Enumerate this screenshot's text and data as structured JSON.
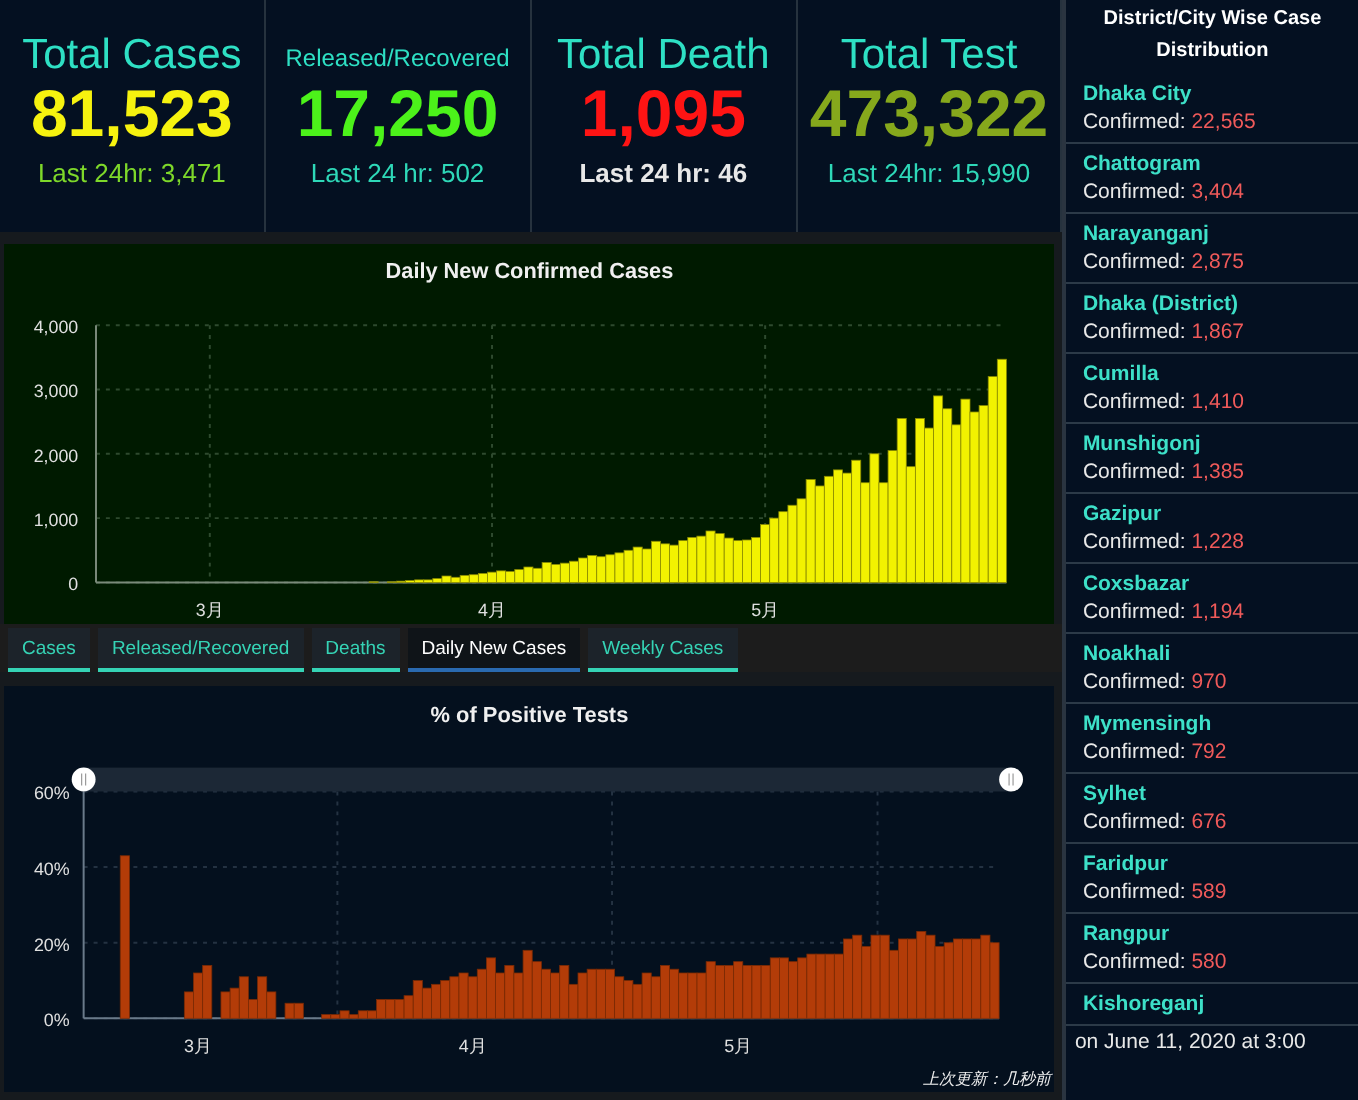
{
  "stats": [
    {
      "title": "Total Cases",
      "value": "81,523",
      "sub": "Last 24hr: 3,471",
      "color": "#f6f20f",
      "kind": "cases"
    },
    {
      "title": "Released/Recovered",
      "value": "17,250",
      "sub": "Last 24 hr: 502",
      "color": "#4cf21a",
      "kind": "recovered"
    },
    {
      "title": "Total Death",
      "value": "1,095",
      "sub": "Last 24 hr: 46",
      "color": "#ff1414",
      "kind": "death"
    },
    {
      "title": "Total Test",
      "value": "473,322",
      "sub": "Last 24hr: 15,990",
      "color": "#86a81c",
      "kind": "test"
    }
  ],
  "daily_chart": {
    "chart_data": {
      "type": "bar",
      "title": "Daily New Confirmed Cases",
      "categories": [
        null,
        null,
        null,
        null,
        null,
        null,
        null,
        null,
        null,
        null,
        null,
        null,
        "3月",
        null,
        null,
        null,
        null,
        null,
        null,
        null,
        null,
        null,
        null,
        null,
        null,
        null,
        null,
        null,
        null,
        null,
        null,
        null,
        null,
        null,
        null,
        null,
        null,
        null,
        null,
        null,
        null,
        null,
        null,
        "4月",
        null,
        null,
        null,
        null,
        null,
        null,
        null,
        null,
        null,
        null,
        null,
        null,
        null,
        null,
        null,
        null,
        null,
        null,
        null,
        null,
        null,
        null,
        null,
        null,
        null,
        null,
        null,
        null,
        null,
        "5月",
        null,
        null,
        null,
        null,
        null,
        null,
        null,
        null,
        null,
        null,
        null,
        null,
        null,
        null,
        null,
        null,
        null,
        null,
        null,
        null,
        null,
        null,
        null,
        null,
        null,
        null
      ],
      "series": [
        {
          "color": "#f2f200",
          "values": [
            0,
            0,
            0,
            0,
            0,
            0,
            0,
            0,
            0,
            0,
            0,
            0,
            0,
            0,
            0,
            0,
            0,
            0,
            0,
            0,
            0,
            0,
            0,
            0,
            0,
            0,
            0,
            0,
            0,
            0,
            10,
            0,
            10,
            20,
            30,
            40,
            40,
            60,
            100,
            80,
            110,
            120,
            140,
            160,
            180,
            170,
            200,
            240,
            220,
            310,
            280,
            300,
            330,
            380,
            420,
            400,
            430,
            460,
            500,
            550,
            520,
            640,
            600,
            580,
            650,
            700,
            720,
            800,
            760,
            690,
            650,
            660,
            700,
            900,
            1000,
            1100,
            1200,
            1300,
            1600,
            1500,
            1650,
            1750,
            1700,
            1900,
            1550,
            2000,
            1550,
            2050,
            2550,
            1800,
            2550,
            2400,
            2900,
            2700,
            2450,
            2850,
            2650,
            2750,
            3200,
            3470
          ]
        }
      ],
      "ylim": [
        0,
        4000
      ],
      "grid": true,
      "yticks": [
        {
          "value": 0,
          "label": "0"
        },
        {
          "value": 1000,
          "label": "1,000"
        },
        {
          "value": 2000,
          "label": "2,000"
        },
        {
          "value": 3000,
          "label": "3,000"
        },
        {
          "value": 4000,
          "label": "4,000"
        }
      ]
    }
  },
  "tabs": [
    {
      "label": "Cases",
      "selected": false
    },
    {
      "label": "Released/Recovered",
      "selected": false
    },
    {
      "label": "Deaths",
      "selected": false
    },
    {
      "label": "Daily New Cases",
      "selected": true
    },
    {
      "label": "Weekly Cases",
      "selected": false
    }
  ],
  "positive_chart": {
    "chart_data": {
      "type": "bar",
      "title": "% of Positive Tests",
      "categories": [
        null,
        null,
        null,
        null,
        null,
        null,
        null,
        null,
        null,
        null,
        null,
        null,
        "3月",
        null,
        null,
        null,
        null,
        null,
        null,
        null,
        null,
        null,
        null,
        null,
        null,
        null,
        null,
        null,
        null,
        null,
        null,
        null,
        null,
        null,
        null,
        null,
        null,
        null,
        null,
        null,
        null,
        null,
        "4月",
        null,
        null,
        null,
        null,
        null,
        null,
        null,
        null,
        null,
        null,
        null,
        null,
        null,
        null,
        null,
        null,
        null,
        null,
        null,
        null,
        null,
        null,
        null,
        null,
        null,
        null,
        null,
        null,
        "5月",
        null,
        null,
        null,
        null,
        null,
        null,
        null,
        null,
        null,
        null,
        null,
        null,
        null,
        null,
        null,
        null,
        null,
        null,
        null,
        null,
        null,
        null,
        null,
        null,
        null,
        null,
        null,
        null
      ],
      "series": [
        {
          "color": "#b33c08",
          "values": [
            0,
            0,
            0,
            0,
            43,
            0,
            0,
            0,
            0,
            0,
            0,
            7,
            12,
            14,
            0,
            7,
            8,
            11,
            5,
            11,
            7,
            0,
            4,
            4,
            0,
            0,
            1,
            1,
            2,
            1,
            2,
            2,
            5,
            5,
            5,
            6,
            10,
            8,
            9,
            10,
            11,
            12,
            11,
            13,
            16,
            12,
            14,
            12,
            18,
            15,
            13,
            12,
            14,
            9,
            12,
            13,
            13,
            13,
            11,
            10,
            9,
            12,
            11,
            14,
            13,
            12,
            12,
            12,
            15,
            14,
            14,
            15,
            14,
            14,
            14,
            16,
            16,
            15,
            16,
            17,
            17,
            17,
            17,
            21,
            22,
            19,
            22,
            22,
            18,
            21,
            21,
            23,
            22,
            19,
            20,
            21,
            21,
            21,
            22,
            20
          ]
        }
      ],
      "ylim": [
        0,
        60
      ],
      "grid": true,
      "yticks": [
        {
          "value": 0,
          "label": "0%"
        },
        {
          "value": 20,
          "label": "20%"
        },
        {
          "value": 40,
          "label": "40%"
        },
        {
          "value": 60,
          "label": "60%"
        }
      ]
    },
    "update_note": "上次更新：几秒前"
  },
  "sidebar": {
    "title": "District/City Wise Case Distribution",
    "districts": [
      {
        "name": "Dhaka City",
        "label": "Confirmed:",
        "count": "22,565"
      },
      {
        "name": "Chattogram",
        "label": "Confirmed:",
        "count": "3,404"
      },
      {
        "name": "Narayanganj",
        "label": "Confirmed:",
        "count": "2,875"
      },
      {
        "name": "Dhaka (District)",
        "label": "Confirmed:",
        "count": "1,867"
      },
      {
        "name": "Cumilla",
        "label": "Confirmed:",
        "count": "1,410"
      },
      {
        "name": "Munshigonj",
        "label": "Confirmed:",
        "count": "1,385"
      },
      {
        "name": "Gazipur",
        "label": "Confirmed:",
        "count": "1,228"
      },
      {
        "name": "Coxsbazar",
        "label": "Confirmed:",
        "count": "1,194"
      },
      {
        "name": "Noakhali",
        "label": "Confirmed:",
        "count": "970"
      },
      {
        "name": "Mymensingh",
        "label": "Confirmed:",
        "count": "792"
      },
      {
        "name": "Sylhet",
        "label": "Confirmed:",
        "count": "676"
      },
      {
        "name": "Faridpur",
        "label": "Confirmed:",
        "count": "589"
      },
      {
        "name": "Rangpur",
        "label": "Confirmed:",
        "count": "580"
      },
      {
        "name": "Kishoreganj"
      }
    ],
    "note": "on June 11, 2020 at 3:00"
  }
}
